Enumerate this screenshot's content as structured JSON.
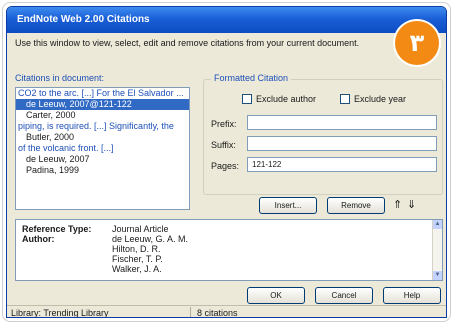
{
  "window": {
    "title": "EndNote Web 2.00 Citations"
  },
  "badge": {
    "text": "٣"
  },
  "instructions": "Use this window to view, select, edit and remove citations from your current document.",
  "citations_label": "Citations in document:",
  "citations": [
    {
      "text": "CO2 to the arc. [...] For the El Salvador ...",
      "kind": "cite",
      "selected": false
    },
    {
      "text": "de Leeuw, 2007@121-122",
      "kind": "auth",
      "selected": true
    },
    {
      "text": "Carter, 2000",
      "kind": "auth",
      "selected": false
    },
    {
      "text": "piping, is required. [...] Significantly, the",
      "kind": "cite",
      "selected": false
    },
    {
      "text": "Butler, 2000",
      "kind": "auth",
      "selected": false
    },
    {
      "text": "of the volcanic front. [...]",
      "kind": "cite",
      "selected": false
    },
    {
      "text": "de Leeuw, 2007",
      "kind": "auth",
      "selected": false
    },
    {
      "text": "Padina, 1999",
      "kind": "auth",
      "selected": false
    }
  ],
  "formatted": {
    "title": "Formatted Citation",
    "exclude_author": "Exclude author",
    "exclude_year": "Exclude year",
    "prefix_label": "Prefix:",
    "prefix_value": "",
    "suffix_label": "Suffix:",
    "suffix_value": "",
    "pages_label": "Pages:",
    "pages_value": "121-122"
  },
  "buttons": {
    "insert": "Insert...",
    "remove": "Remove",
    "ok": "OK",
    "cancel": "Cancel",
    "help": "Help"
  },
  "detail": {
    "type_label": "Reference Type:",
    "type_value": "Journal Article",
    "author_label": "Author:",
    "authors": [
      "de Leeuw, G. A. M.",
      "Hilton, D. R.",
      "Fischer, T. P.",
      "Walker, J. A."
    ]
  },
  "status": {
    "library": "Library: Trending Library",
    "count": "8 citations"
  },
  "colors": {
    "badge": "#f28a14",
    "selection": "#316ac5",
    "titlebar": "#1a5fd6"
  },
  "icons": [
    "move-up-arrow-icon",
    "move-down-arrow-icon",
    "scroll-up-icon",
    "scroll-down-icon"
  ]
}
